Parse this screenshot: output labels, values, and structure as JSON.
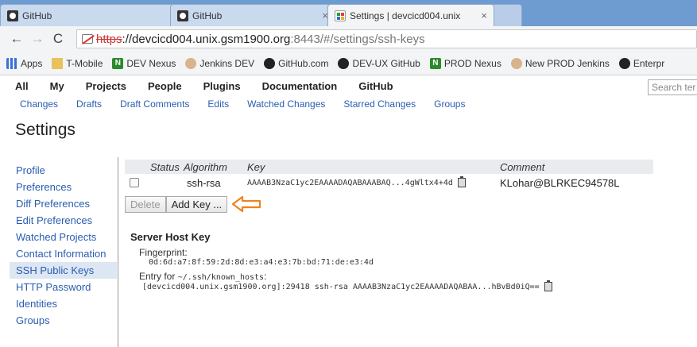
{
  "browser": {
    "tabs": [
      {
        "label": "GitHub",
        "active": false
      },
      {
        "label": "GitHub",
        "active": false
      },
      {
        "label": "Settings | devcicd004.unix",
        "active": true
      }
    ],
    "tab_close_glyph": "×",
    "address": {
      "scheme": "https",
      "host": "://devcicd004.unix.gsm1900.org",
      "path": ":8443/#/settings/ssh-keys"
    },
    "bookmarks": [
      {
        "label": "Apps",
        "icon": "apps-icon"
      },
      {
        "label": "T-Mobile",
        "icon": "folder-icon"
      },
      {
        "label": "DEV Nexus",
        "icon": "nexus-icon"
      },
      {
        "label": "Jenkins DEV",
        "icon": "jenkins-icon"
      },
      {
        "label": "GitHub.com",
        "icon": "github-icon"
      },
      {
        "label": "DEV-UX GitHub",
        "icon": "github-icon"
      },
      {
        "label": "PROD Nexus",
        "icon": "nexus-icon"
      },
      {
        "label": "New PROD Jenkins",
        "icon": "jenkins-icon"
      },
      {
        "label": "Enterpr",
        "icon": "github-icon"
      }
    ]
  },
  "gerrit": {
    "menu": [
      "All",
      "My",
      "Projects",
      "People",
      "Plugins",
      "Documentation",
      "GitHub"
    ],
    "search_placeholder": "Search ter",
    "submenu": [
      "Changes",
      "Drafts",
      "Draft Comments",
      "Edits",
      "Watched Changes",
      "Starred Changes",
      "Groups"
    ],
    "page_title": "Settings",
    "sidebar": [
      {
        "label": "Profile",
        "active": false
      },
      {
        "label": "Preferences",
        "active": false
      },
      {
        "label": "Diff Preferences",
        "active": false
      },
      {
        "label": "Edit Preferences",
        "active": false
      },
      {
        "label": "Watched Projects",
        "active": false
      },
      {
        "label": "Contact Information",
        "active": false
      },
      {
        "label": "SSH Public Keys",
        "active": true
      },
      {
        "label": "HTTP Password",
        "active": false
      },
      {
        "label": "Identities",
        "active": false
      },
      {
        "label": "Groups",
        "active": false
      }
    ],
    "keys_table": {
      "headers": {
        "status": "Status",
        "algorithm": "Algorithm",
        "key": "Key",
        "comment": "Comment"
      },
      "rows": [
        {
          "status": "",
          "algorithm": "ssh-rsa",
          "key": "AAAAB3NzaC1yc2EAAAADAQABAAABAQ...4gWltx4+4d",
          "comment": "KLohar@BLRKEC94578L"
        }
      ]
    },
    "buttons": {
      "delete": "Delete",
      "add_key": "Add Key ..."
    },
    "host_key": {
      "title": "Server Host Key",
      "fingerprint_label": "Fingerprint:",
      "fingerprint": "0d:6d:a7:8f:59:2d:8d:e3:a4:e3:7b:bd:71:de:e3:4d",
      "entry_label_prefix": "Entry for ",
      "entry_label_path": "~/.ssh/known_hosts",
      "entry_label_suffix": ":",
      "entry": "[devcicd004.unix.gsm1900.org]:29418 ssh-rsa AAAAB3NzaC1yc2EAAAADAQABAA...hBvBd0iQ=="
    }
  },
  "colors": {
    "link": "#2a5db0",
    "annotation_arrow": "#f0821e",
    "tabstrip": "#6e9bd0"
  }
}
